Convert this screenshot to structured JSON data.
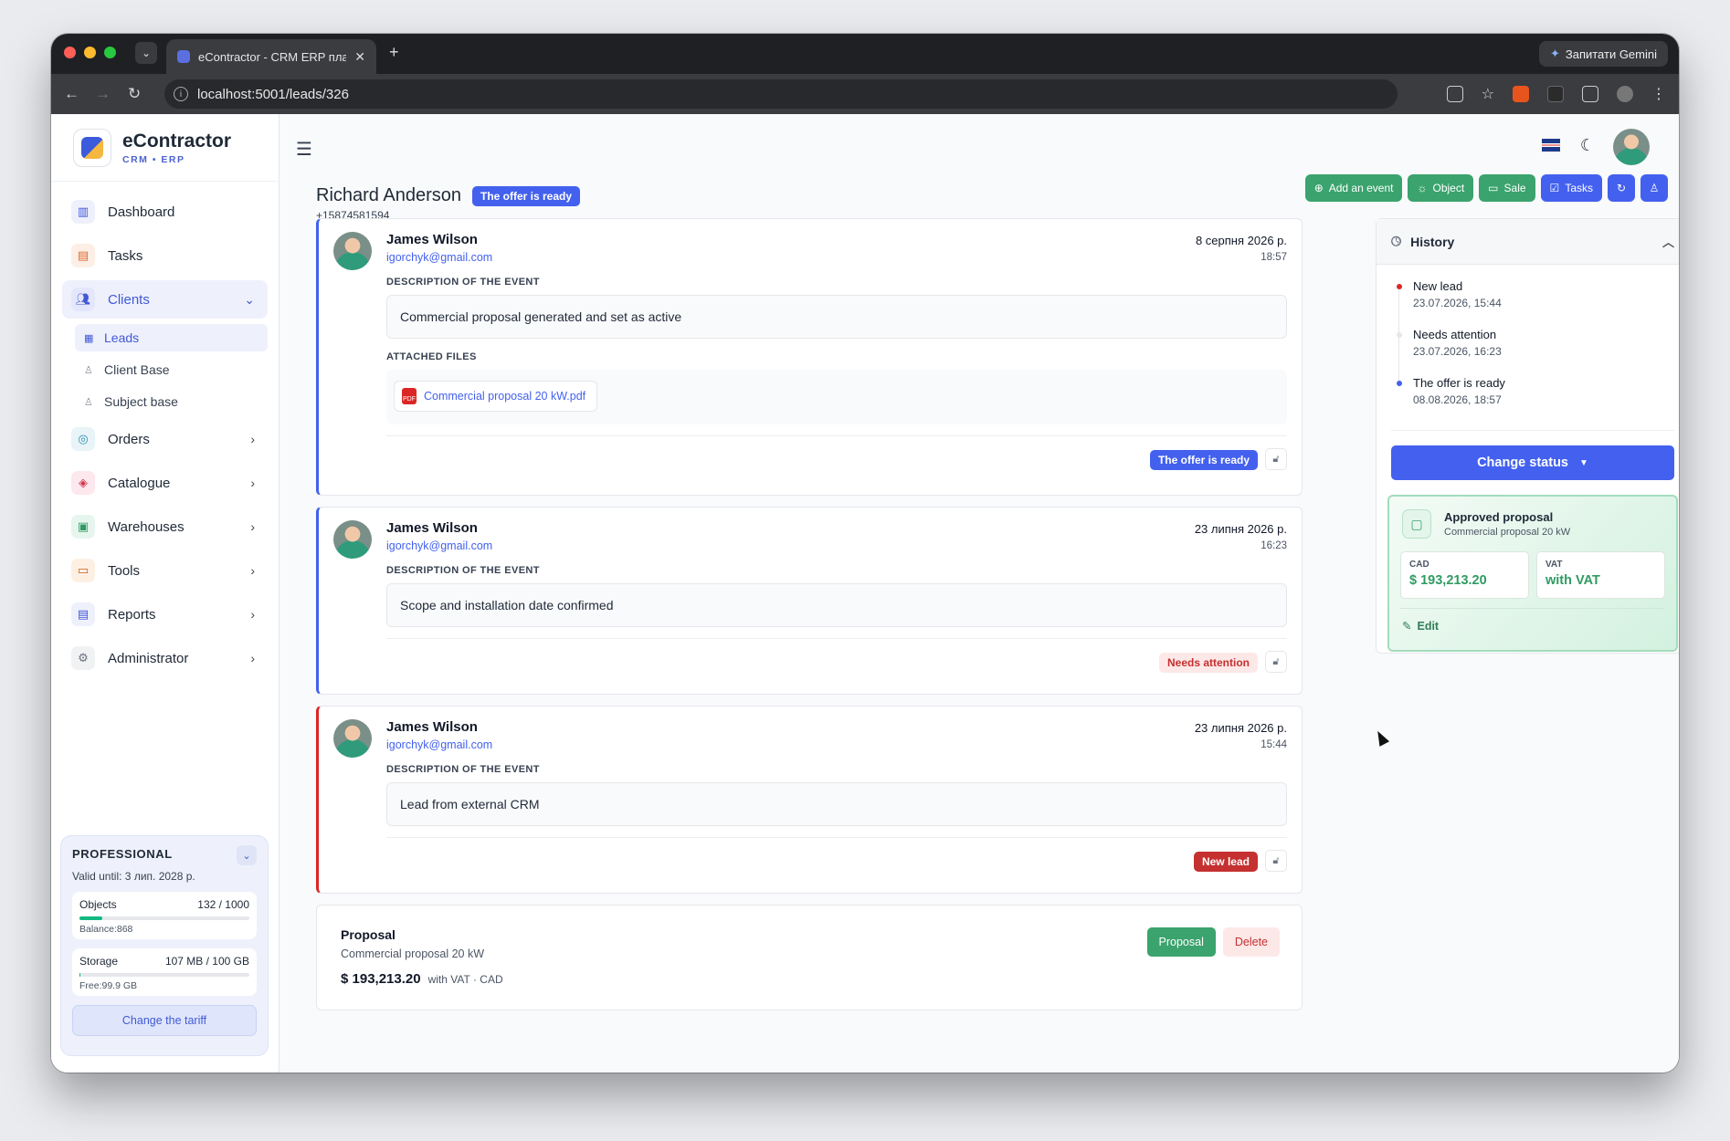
{
  "browser": {
    "tab_title": "eContractor - CRM ERP плате",
    "url": "localhost:5001/leads/326",
    "gemini_label": "Запитати Gemini"
  },
  "brand": {
    "name": "eContractor",
    "sub": "CRM • ERP"
  },
  "sidebar": {
    "items": [
      {
        "label": "Dashboard"
      },
      {
        "label": "Tasks"
      },
      {
        "label": "Clients"
      },
      {
        "label": "Orders"
      },
      {
        "label": "Catalogue"
      },
      {
        "label": "Warehouses"
      },
      {
        "label": "Tools"
      },
      {
        "label": "Reports"
      },
      {
        "label": "Administrator"
      }
    ],
    "clients_sub": [
      {
        "label": "Leads"
      },
      {
        "label": "Client Base"
      },
      {
        "label": "Subject base"
      }
    ]
  },
  "plan": {
    "title": "PROFESSIONAL",
    "valid": "Valid until: 3 лип. 2028 р.",
    "objects_label": "Objects",
    "objects_value": "132 / 1000",
    "objects_fraction": 0.132,
    "objects_balance": "Balance:868",
    "storage_label": "Storage",
    "storage_value": "107 MB / 100 GB",
    "storage_fraction": 0.001,
    "storage_free": "Free:99.9 GB",
    "change_label": "Change the tariff"
  },
  "lead": {
    "name": "Richard Anderson",
    "status": "The offer is ready",
    "phone": "+15874581594"
  },
  "actions": {
    "add_event": "Add an event",
    "object": "Object",
    "sale": "Sale",
    "tasks": "Tasks"
  },
  "events": [
    {
      "author": "James Wilson",
      "email": "igorchyk@gmail.com",
      "date": "8 серпня 2026 р.",
      "time": "18:57",
      "desc_label": "DESCRIPTION OF THE EVENT",
      "desc": "Commercial proposal generated and set as active",
      "files_label": "ATTACHED FILES",
      "file": "Commercial proposal 20 kW.pdf",
      "status": "The offer is ready"
    },
    {
      "author": "James Wilson",
      "email": "igorchyk@gmail.com",
      "date": "23 липня 2026 р.",
      "time": "16:23",
      "desc_label": "DESCRIPTION OF THE EVENT",
      "desc": "Scope and installation date confirmed",
      "status": "Needs attention"
    },
    {
      "author": "James Wilson",
      "email": "igorchyk@gmail.com",
      "date": "23 липня 2026 р.",
      "time": "15:44",
      "desc_label": "DESCRIPTION OF THE EVENT",
      "desc": "Lead from external CRM",
      "status": "New lead"
    }
  ],
  "proposal": {
    "title": "Proposal",
    "subtitle": "Commercial proposal 20 kW",
    "amount": "$ 193,213.20",
    "meta": "with VAT · CAD",
    "btn_proposal": "Proposal",
    "btn_delete": "Delete"
  },
  "history": {
    "title": "History",
    "items": [
      {
        "name": "New lead",
        "time": "23.07.2026, 15:44"
      },
      {
        "name": "Needs attention",
        "time": "23.07.2026, 16:23"
      },
      {
        "name": "The offer is ready",
        "time": "08.08.2026, 18:57"
      }
    ],
    "change_status": "Change status",
    "approved": {
      "title": "Approved proposal",
      "subtitle": "Commercial proposal 20 kW",
      "cad_label": "CAD",
      "cad_value": "$ 193,213.20",
      "vat_label": "VAT",
      "vat_value": "with VAT",
      "edit": "Edit"
    }
  }
}
